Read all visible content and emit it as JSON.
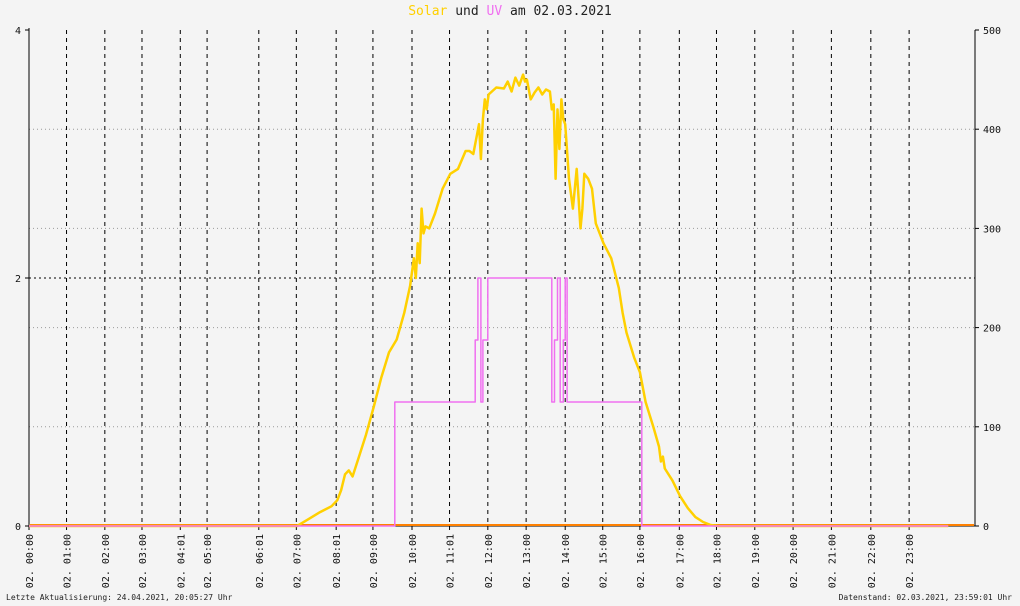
{
  "title": {
    "solar": "Solar",
    "und": "und",
    "uv": "UV",
    "rest": "am 02.03.2021"
  },
  "footer": {
    "left": "Letzte Aktualisierung: 24.04.2021, 20:05:27 Uhr",
    "right": "Datenstand: 02.03.2021, 23:59:01 Uhr"
  },
  "colors": {
    "solar": "#ffd000",
    "uv": "#f070f0",
    "baseline": "#ff8000",
    "grid": "#000000",
    "background": "#f4f4f4"
  },
  "chart_data": {
    "type": "line",
    "grid": true,
    "y_left": {
      "range": [
        0,
        4
      ],
      "ticks": [
        0,
        2,
        4
      ]
    },
    "y_right": {
      "range": [
        0,
        500
      ],
      "ticks": [
        0,
        100,
        200,
        300,
        400,
        500
      ]
    },
    "x_range": [
      0,
      24.7
    ],
    "x_tick_positions": [
      0,
      0.98,
      1.98,
      2.95,
      3.95,
      4.65,
      6.0,
      6.98,
      8.02,
      8.98,
      10.0,
      10.98,
      11.98,
      12.98,
      14.0,
      14.98,
      15.95,
      16.98,
      17.95,
      18.95,
      19.95,
      20.95,
      21.98,
      22.98
    ],
    "x_tick_labels": [
      "02. 00:00",
      "02. 01:00",
      "02. 02:00",
      "02. 03:00",
      "02. 04:01",
      "02. 05:00",
      "02. 06:01",
      "02. 07:00",
      "02. 08:01",
      "02. 09:00",
      "02. 10:00",
      "02. 11:01",
      "02. 12:00",
      "02. 13:00",
      "02. 14:00",
      "02. 15:00",
      "02. 16:00",
      "02. 17:00",
      "02. 18:00",
      "02. 19:00",
      "02. 20:00",
      "02. 21:00",
      "02. 22:00",
      "02. 23:00"
    ],
    "series": [
      {
        "name": "Solar",
        "axis": "right",
        "x": [
          0,
          7.0,
          7.3,
          7.6,
          7.9,
          8.05,
          8.15,
          8.25,
          8.35,
          8.45,
          8.6,
          8.8,
          9.0,
          9.2,
          9.4,
          9.6,
          9.8,
          9.95,
          10.05,
          10.1,
          10.15,
          10.2,
          10.25,
          10.3,
          10.35,
          10.45,
          10.6,
          10.8,
          11.0,
          11.2,
          11.4,
          11.5,
          11.6,
          11.7,
          11.75,
          11.8,
          11.85,
          11.9,
          11.95,
          12.0,
          12.2,
          12.4,
          12.5,
          12.6,
          12.7,
          12.8,
          12.9,
          12.95,
          13.0,
          13.1,
          13.2,
          13.3,
          13.4,
          13.5,
          13.6,
          13.65,
          13.7,
          13.75,
          13.8,
          13.85,
          13.9,
          13.95,
          14.0,
          14.1,
          14.2,
          14.25,
          14.3,
          14.35,
          14.4,
          14.45,
          14.5,
          14.6,
          14.7,
          14.8,
          14.9,
          15.0,
          15.2,
          15.4,
          15.5,
          15.6,
          15.8,
          15.95,
          16.1,
          16.3,
          16.45,
          16.5,
          16.55,
          16.6,
          16.8,
          17.0,
          17.2,
          17.4,
          17.6,
          17.8,
          18.0,
          18.1,
          18.2,
          24.0
        ],
        "values": [
          0,
          0,
          7,
          14,
          20,
          26,
          36,
          52,
          56,
          50,
          68,
          92,
          120,
          150,
          175,
          188,
          215,
          242,
          270,
          250,
          285,
          265,
          320,
          295,
          302,
          300,
          315,
          340,
          355,
          360,
          378,
          378,
          375,
          395,
          405,
          370,
          410,
          430,
          420,
          435,
          442,
          441,
          448,
          438,
          452,
          444,
          455,
          448,
          450,
          430,
          437,
          442,
          435,
          440,
          438,
          420,
          425,
          350,
          420,
          380,
          430,
          410,
          405,
          350,
          320,
          340,
          360,
          330,
          300,
          320,
          355,
          350,
          340,
          305,
          295,
          285,
          270,
          240,
          215,
          195,
          170,
          155,
          125,
          100,
          80,
          65,
          70,
          58,
          46,
          30,
          18,
          9,
          4,
          1,
          0,
          0,
          0,
          0
        ]
      },
      {
        "name": "UV",
        "axis": "left",
        "x": [
          0,
          9.55,
          9.55,
          11.65,
          11.65,
          11.72,
          11.72,
          11.8,
          11.8,
          11.85,
          11.85,
          11.98,
          11.98,
          13.65,
          13.65,
          13.72,
          13.72,
          13.8,
          13.8,
          13.87,
          13.87,
          13.95,
          13.95,
          14.0,
          14.0,
          14.05,
          14.05,
          16.0,
          16.0,
          24.0
        ],
        "values": [
          0,
          0,
          1,
          1,
          1.5,
          1.5,
          2,
          2,
          1,
          1,
          1.5,
          1.5,
          2,
          2,
          1,
          1,
          1.5,
          1.5,
          2,
          2,
          1,
          1,
          1.5,
          1.5,
          2,
          2,
          1,
          1,
          0,
          0
        ]
      }
    ]
  }
}
